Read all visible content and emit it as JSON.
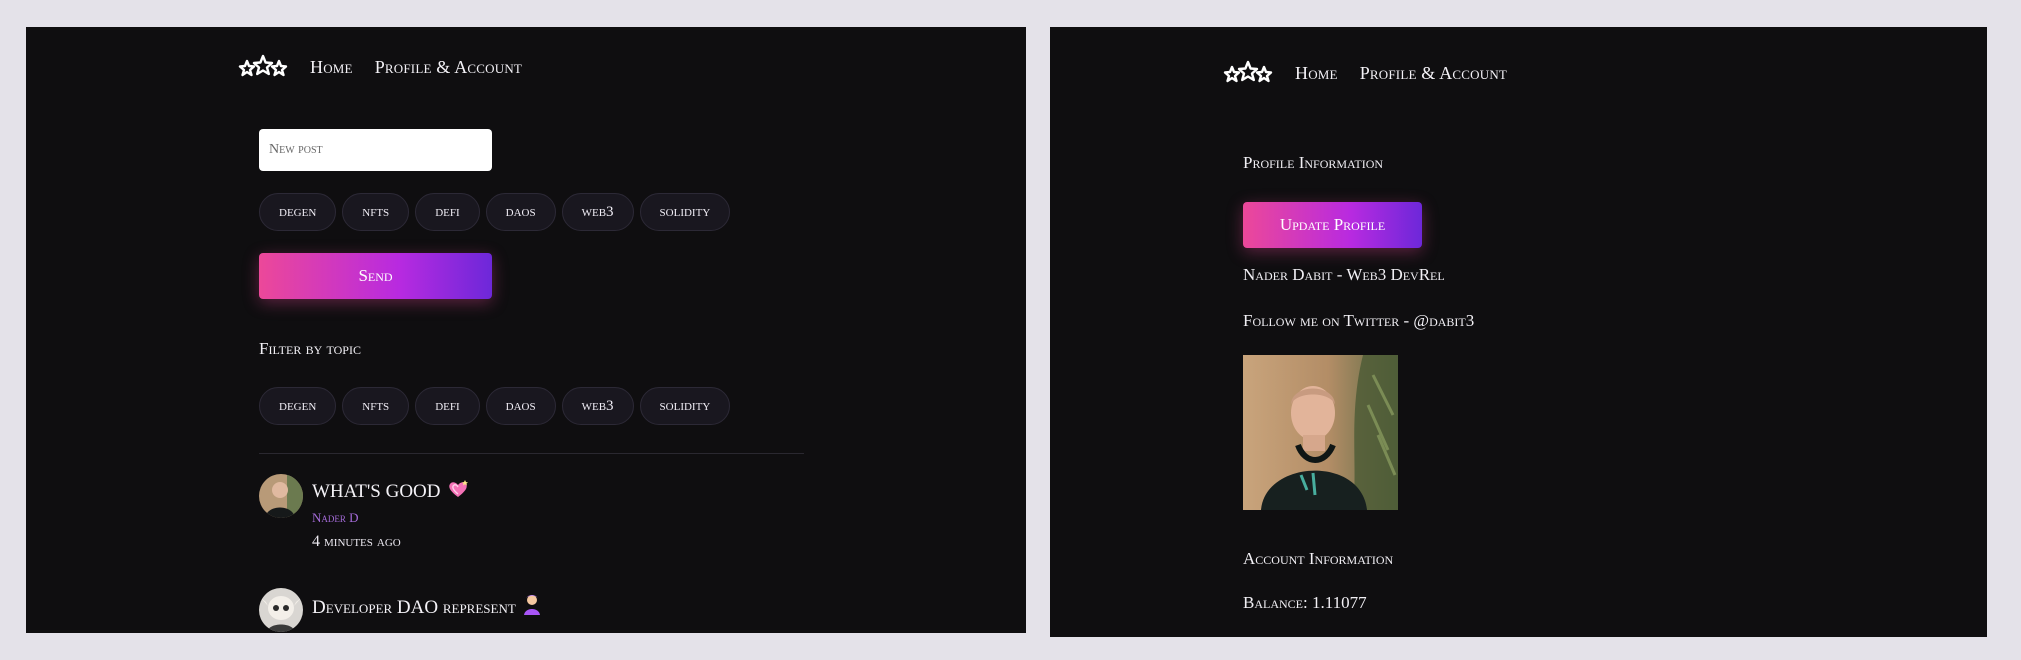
{
  "feed_page": {
    "nav": {
      "home": "Home",
      "profile": "Profile & Account"
    },
    "new_post": {
      "placeholder": "New post",
      "value": ""
    },
    "compose_tags": [
      "degen",
      "nfts",
      "defi",
      "daos",
      "web3",
      "solidity"
    ],
    "send_label": "Send",
    "filter_label": "Filter by topic",
    "filter_tags": [
      "degen",
      "nfts",
      "defi",
      "daos",
      "web3",
      "solidity"
    ],
    "posts": [
      {
        "title": "WHAT'S GOOD",
        "author": "Nader D",
        "time": "4 minutes ago"
      },
      {
        "title": "Developer DAO represent",
        "author": "",
        "time": ""
      }
    ]
  },
  "profile_page": {
    "nav": {
      "home": "Home",
      "profile": "Profile & Account"
    },
    "profile_info_heading": "Profile Information",
    "update_button": "Update Profile",
    "bio": "Nader Dabit - Web3 DevRel",
    "twitter": "Follow me on Twitter - @dabit3",
    "account_heading": "Account Information",
    "balance": "Balance: 1.11077"
  },
  "colors": {
    "background": "#e4e2e9",
    "panel": "#0f0e10",
    "tag_bg": "#19171f",
    "accent_start": "#ec4899",
    "accent_end": "#6d28d9",
    "author": "#a46bd8"
  },
  "icons": {
    "logo": "three-stars-icon",
    "post1_emoji": "sparkling-heart-icon",
    "post2_emoji": "person-emoji-icon"
  }
}
